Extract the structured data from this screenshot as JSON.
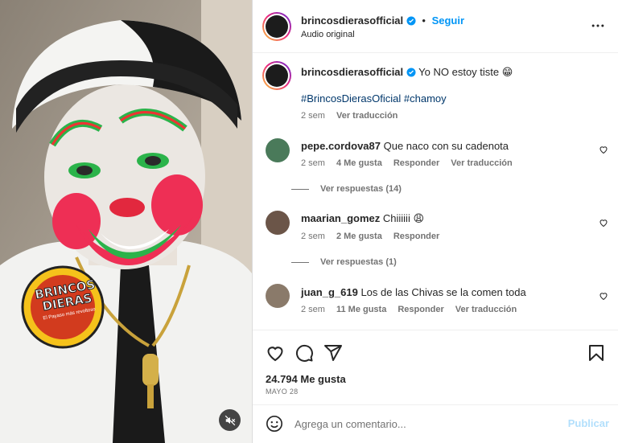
{
  "colors": {
    "link": "#0095f6",
    "hashtag": "#00376b",
    "muted": "#737373",
    "publish_disabled": "#b2dffc"
  },
  "media": {
    "logo_text": "BRINCOS DIERAS",
    "logo_subtext": "El Payaso más revoltoso",
    "mute_icon": "speaker-muted-icon"
  },
  "header": {
    "username": "brincosdierasofficial",
    "separator": "•",
    "follow_label": "Seguir",
    "audio_label": "Audio original",
    "more_icon": "more-options-icon"
  },
  "caption": {
    "username": "brincosdierasofficial",
    "text": "Yo NO estoy tiste 😁",
    "hashtags": "#BrincosDierasOficial #chamoy",
    "time": "2 sem",
    "translate": "Ver traducción"
  },
  "comments": [
    {
      "username": "pepe.cordova87",
      "text": "Que naco con su cadenota",
      "time": "2 sem",
      "likes": "4 Me gusta",
      "reply": "Responder",
      "translate": "Ver traducción",
      "replies_label": "Ver respuestas (14)"
    },
    {
      "username": "maarian_gomez",
      "text": "Chiiiiii 😩",
      "time": "2 sem",
      "likes": "2 Me gusta",
      "reply": "Responder",
      "replies_label": "Ver respuestas (1)"
    },
    {
      "username": "juan_g_619",
      "text": "Los de las Chivas se la comen toda",
      "time": "2 sem",
      "likes": "11 Me gusta",
      "reply": "Responder",
      "translate": "Ver traducción"
    }
  ],
  "actions": {
    "like_icon": "heart-icon",
    "comment_icon": "comment-icon",
    "share_icon": "share-icon",
    "save_icon": "bookmark-icon",
    "likes_count": "24.794 Me gusta",
    "date": "MAYO 28"
  },
  "comment_box": {
    "emoji_icon": "emoji-icon",
    "placeholder": "Agrega un comentario...",
    "publish_label": "Publicar"
  }
}
